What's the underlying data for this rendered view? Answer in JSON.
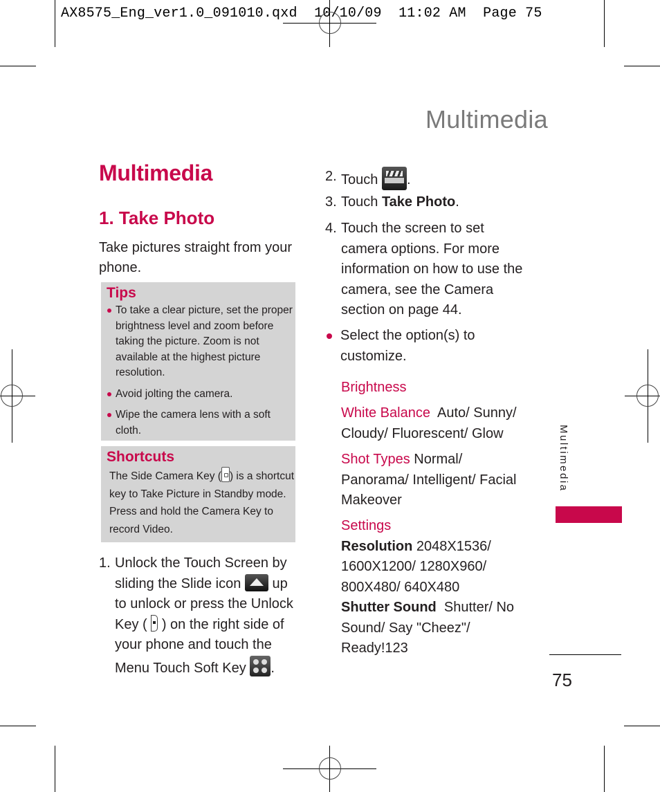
{
  "slug": {
    "filename": "AX8575_Eng_ver1.0_091010.qxd",
    "date": "10/10/09",
    "time": "11:02 AM",
    "page_label": "Page 75"
  },
  "running_title": "Multimedia",
  "section_title": "Multimedia",
  "subsection_title": "1. Take Photo",
  "intro": "Take pictures straight from your phone.",
  "tips": {
    "title": "Tips",
    "items": [
      "To take a clear picture, set the proper brightness level and zoom before taking the picture. Zoom is not available at the highest picture resolution.",
      "Avoid jolting the camera.",
      "Wipe the camera lens with a soft cloth."
    ]
  },
  "shortcuts": {
    "title": "Shortcuts",
    "text_before_icon": "The Side Camera Key (",
    "icon": "side-camera-key-icon",
    "text_after_icon": ") is a shortcut key to Take Picture in Standby mode. Press and hold the Camera Key to record Video."
  },
  "steps": {
    "step1": {
      "num": "1.",
      "part1": "Unlock the Touch Screen by sliding the Slide icon",
      "part2": "up to unlock or press the Unlock Key (",
      "part3": ") on the right side of your phone and touch the Menu Touch Soft Key",
      "part4": ".",
      "icons": [
        "slide-icon",
        "unlock-key-icon",
        "menu-soft-key-icon"
      ]
    },
    "step2": {
      "num": "2.",
      "before": "Touch",
      "after": ".",
      "icon": "multimedia-icon"
    },
    "step3": {
      "num": "3.",
      "before": "Touch",
      "bold": "Take Photo",
      "after": "."
    },
    "step4": {
      "num": "4.",
      "text": "Touch the screen to set camera options. For more information on how to use the camera, see the Camera section on page 44."
    }
  },
  "select_bullet": "Select the option(s) to customize.",
  "options": {
    "brightness": {
      "label": "Brightness"
    },
    "white_balance": {
      "label": "White Balance",
      "values": "Auto/ Sunny/ Cloudy/ Fluorescent/ Glow"
    },
    "shot_types": {
      "label": "Shot Types",
      "values": "Normal/ Panorama/ Intelligent/ Facial Makeover"
    },
    "settings": {
      "label": "Settings",
      "resolution": {
        "label": "Resolution",
        "values": "2048X1536/ 1600X1200/ 1280X960/ 800X480/ 640X480"
      },
      "shutter_sound": {
        "label": "Shutter Sound",
        "values": "Shutter/ No Sound/ Say \"Cheez\"/ Ready!123"
      }
    }
  },
  "side_tab": "Multimedia",
  "page_number": "75",
  "colors": {
    "accent": "#c8084b",
    "box_bg": "#d4d4d4",
    "running_title": "#7a7a7a"
  }
}
